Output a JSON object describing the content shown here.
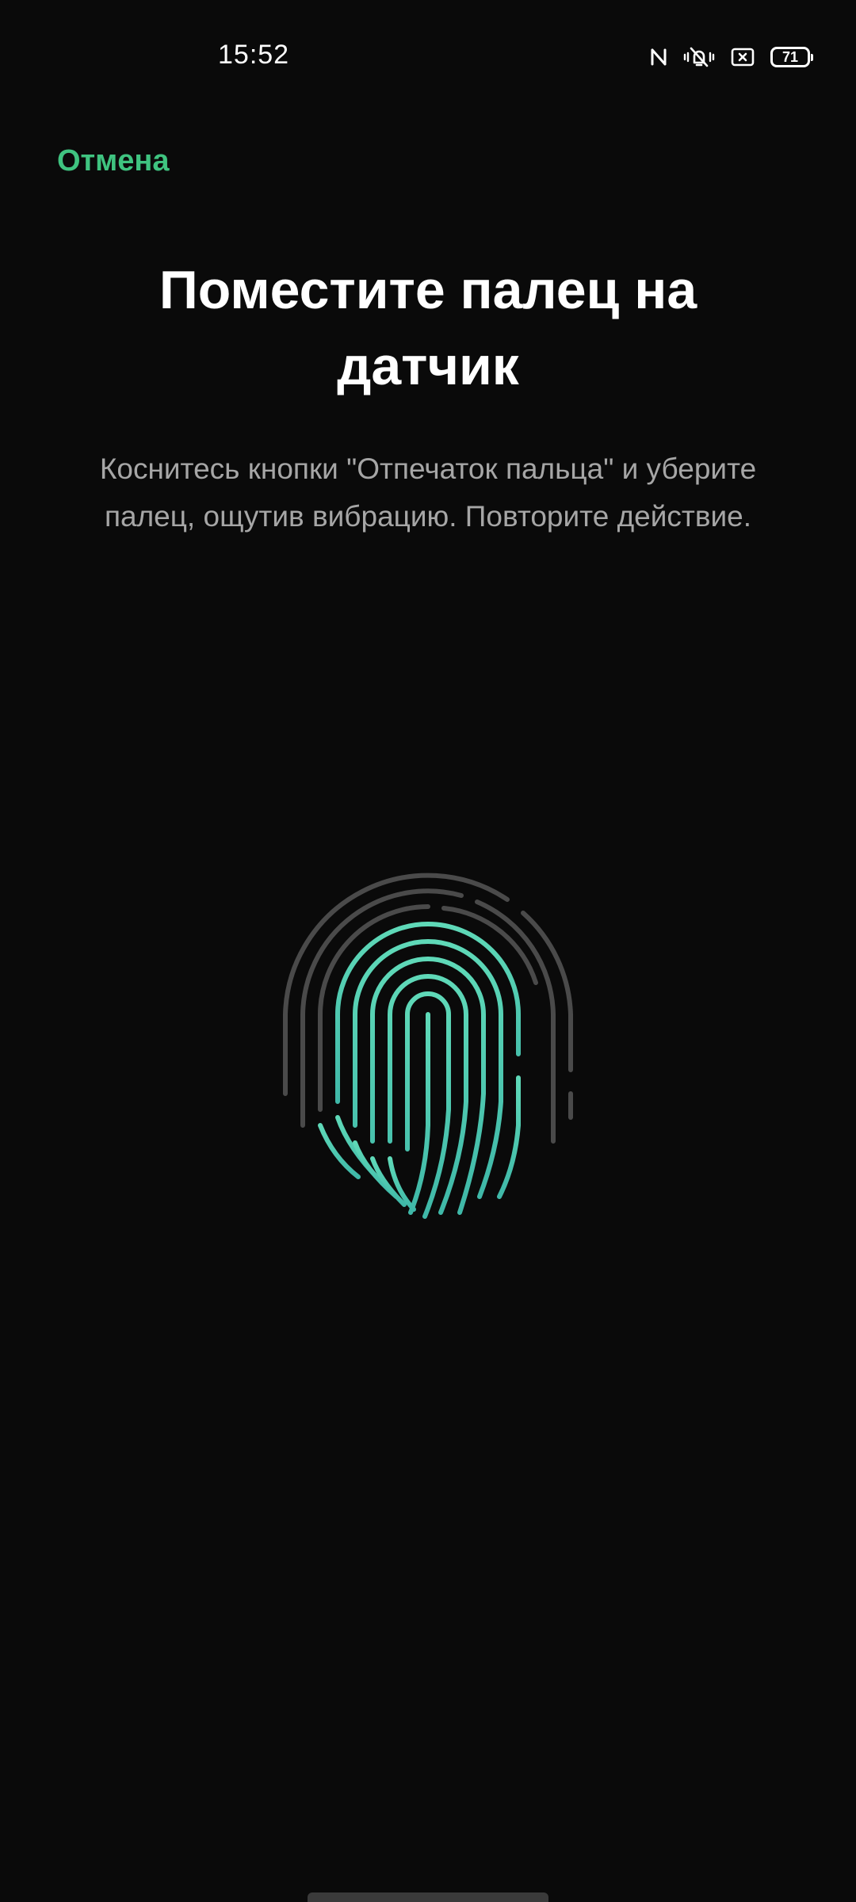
{
  "status_bar": {
    "time": "15:52",
    "icons": [
      "nfc-icon",
      "vibrate-mute-icon",
      "screen-record-icon"
    ],
    "battery_level": "71"
  },
  "header": {
    "cancel_label": "Отмена"
  },
  "main": {
    "title": "Поместите палец на датчик",
    "instruction": "Коснитесь кнопки \"Отпечаток пальца\" и уберите палец, ощутив вибрацию. Повторите действие.",
    "fingerprint_icon": "fingerprint-icon"
  },
  "colors": {
    "accent": "#3fc380",
    "fingerprint_active": "#4fd1b0",
    "fingerprint_inactive": "#4a4a4a",
    "background": "#0a0a0a"
  }
}
